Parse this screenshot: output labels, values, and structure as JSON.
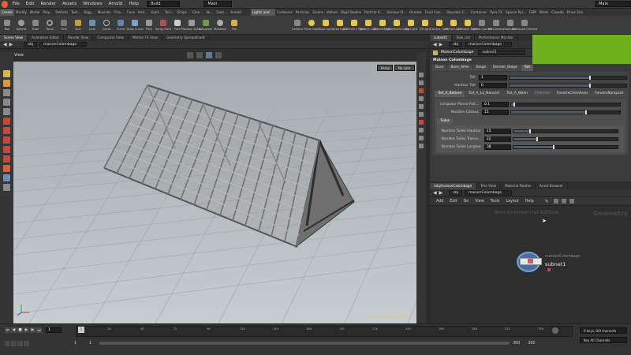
{
  "menubar": {
    "items": [
      "File",
      "Edit",
      "Render",
      "Assets",
      "Windows",
      "Arnold",
      "Help"
    ],
    "desktop": "Build",
    "context": "Main",
    "right_context": "Main"
  },
  "shelf_tabs": [
    "Create",
    "Modify",
    "Model",
    "Poly...",
    "Deform",
    "Text...",
    "Rigg...",
    "Muscles",
    "Cha...",
    "Cons",
    "Hair...",
    "Guid...",
    "Terr...",
    "Simpl...",
    "Clou...",
    "Vo...",
    "Gam...",
    "Arnold"
  ],
  "shelf_tabs_right": [
    "Lights and ...",
    "Collisions",
    "Particles",
    "Grains",
    "Vellum",
    "Rigid Bodies",
    "Particle Fl...",
    "Viscous Fl...",
    "Oceans",
    "Fluid Con...",
    "Populate C...",
    "Container",
    "Pyro FX",
    "Sparse Pyr...",
    "FEM",
    "Wires",
    "Crowds",
    "Drive Sim"
  ],
  "shelf_tools": [
    "Box",
    "Sphere",
    "Tube",
    "Torus",
    "Grid",
    "Null",
    "Line",
    "Circle",
    "Curve",
    "Draw Curve",
    "Path",
    "Spray Paint",
    "Font",
    "Platonic Solids",
    "L-System",
    "Metaball",
    "File"
  ],
  "shelf_tools_right": [
    "Camera",
    "Point Light",
    "Spot Light",
    "Area Light",
    "Geometry Light",
    "Volume Light",
    "Distant Light",
    "Environment Light",
    "Sky Light",
    "GI Light",
    "Caustic Light",
    "Portal Light",
    "Ambient Light",
    "Stereo Camera",
    "VR Camera",
    "Switcher",
    "Gamepad Camera"
  ],
  "viewport": {
    "tabs": [
      "Scene View",
      "Animation Editor",
      "Render View",
      "Composite View",
      "Motion FX View",
      "Geometry Spreadsheet"
    ],
    "path_root": "obj",
    "path_node": "maisonColombage",
    "title": "View",
    "persp_label": "Persp",
    "cam_label": "No cam",
    "watermark": "Non-Commercial Edition"
  },
  "params": {
    "tabs": [
      "subnet1",
      "Take List",
      "Performance Monitor"
    ],
    "path_root": "obj",
    "path_node": "maisonColombage",
    "node_type": "MaisonColombage",
    "node_name": "subnet1",
    "heading": "Maison Colombage",
    "main_tabs": [
      "Base",
      "Base_Allée",
      "Etage",
      "Dernier_Etage",
      "Toit"
    ],
    "fields_top": [
      {
        "label": "Toit",
        "value": "1"
      },
      {
        "label": "Hauteur Toit",
        "value": "0"
      }
    ],
    "sub_tabs": [
      "Toit_A_Batiere",
      "Toit_A_La_Mansart",
      "Toit_A_Walm",
      "Chemine",
      "FenetreChienAssis",
      "FenetreRampant"
    ],
    "fields_mid": [
      {
        "label": "Longueur Panne Fait...",
        "value": "0.1"
      },
      {
        "label": "Nombre Liteaux",
        "value": "15"
      }
    ],
    "tuiles_label": "Tuiles",
    "fields_tuiles": [
      {
        "label": "Nombre Tuiles Hauteur",
        "value": "15"
      },
      {
        "label": "Nombre Tuiles Transv...",
        "value": "22"
      },
      {
        "label": "Nombre Tuiles Longeur",
        "value": "38"
      }
    ]
  },
  "network": {
    "tabs": [
      "/obj/maisonColombage",
      "Tree View",
      "Material Palette",
      "Asset Browser"
    ],
    "path_root": "obj",
    "path_node": "maisonColombage",
    "menu": [
      "Add",
      "Edit",
      "Go",
      "View",
      "Tools",
      "Layout",
      "Help"
    ],
    "watermark": "Non-Commercial Edition",
    "context_label": "Geometry",
    "node_label_1": "maisonColombage",
    "node_label_2": "subnet1"
  },
  "timeline": {
    "ticks": [
      "24",
      "48",
      "72",
      "96",
      "120",
      "144",
      "168",
      "192",
      "216",
      "240",
      "264",
      "288",
      "312",
      "336"
    ],
    "current_frame": "1",
    "frame_marker": "1",
    "start_frame": "1",
    "start_field": "1",
    "end_frame": "360",
    "end_field": "360",
    "keys_label": "0 keys, 0/0 channels",
    "key_channels": "Key All Channels"
  },
  "colors": {
    "accent_green": "#6fb21e",
    "panel": "#3b3b3b",
    "viewport_sky": "#b3babe"
  }
}
